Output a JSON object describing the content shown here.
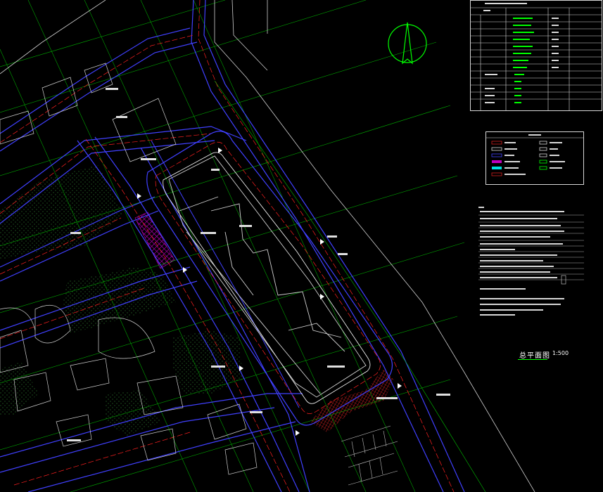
{
  "drawing": {
    "title": "总平面图",
    "scale": "1:500"
  },
  "colors": {
    "background": "#000000",
    "road_edge": "#4040ff",
    "centerline": "#ff2020",
    "axis_grid": "#00c000",
    "building": "#d0d0d0",
    "hatch_green": "#2f7f2f",
    "hatch_magenta": "#c000c0",
    "hatch_red": "#d02020",
    "annotation": "#e0e0e0"
  },
  "icons": [
    "north-arrow-icon",
    "legend-swatch-icons"
  ]
}
